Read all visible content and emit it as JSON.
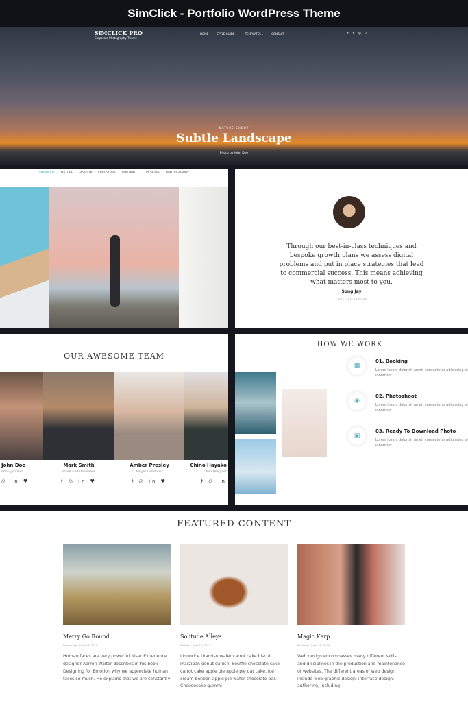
{
  "banner": {
    "title": "SimClick - Portfolio WordPress Theme"
  },
  "hero": {
    "logo": "SIMCLICK PRO",
    "tagline": "Corporate Photography Theme",
    "nav": [
      "HOME",
      "STYLE GUIDE ▾",
      "TEMPLATES ▾",
      "CONTACT"
    ],
    "social": [
      "f",
      "t",
      "◎",
      "⌕"
    ],
    "kicker": "NATURE SHOOT",
    "title": "Subtle Landscape",
    "caption": "Photo by John Doe"
  },
  "portfolio": {
    "tabs": [
      "SHOW ALL",
      "NATURE",
      "FASHION",
      "LANDSCAPE",
      "PORTRAIT",
      "CITY SCAPE",
      "PHOTOGRAPHY"
    ]
  },
  "testimonial": {
    "quote": "Through our best-in-class techniques and bespoke growth plans we assess digital problems and put in place strategies that lead to commercial success. This means achieving what matters most to you.",
    "name": "Song Jay",
    "role": "CFO, TAC Limited"
  },
  "team": {
    "title": "OUR AWESOME TEAM",
    "members": [
      {
        "name": "John Doe",
        "role": "Photographer",
        "icons": "◎ in ♥"
      },
      {
        "name": "Mark Smith",
        "role": "Front End Developer",
        "icons": "f ◎ in ♥"
      },
      {
        "name": "Amber Presley",
        "role": "Plugin Developer",
        "icons": "f ◎ in ♥"
      },
      {
        "name": "Chino Hayako",
        "role": "Web Designer",
        "icons": "f ◎ in"
      }
    ]
  },
  "how": {
    "title": "HOW WE WORK",
    "steps": [
      {
        "title": "01. Booking",
        "text": "Lorem ipsum dolor sit amet, consectetur adipiscing elit. Donec eu lobortiser."
      },
      {
        "title": "02. Photoshoot",
        "text": "Lorem ipsum dolor sit amet, consectetur adipiscing elit. Donec eu lobortiser."
      },
      {
        "title": "03. Ready To Download Photo",
        "text": "Lorem ipsum dolor sit amet, consectetur adipiscing elit. Donec eu lobortiser."
      }
    ]
  },
  "featured": {
    "title": "FEATURED CONTENT",
    "posts": [
      {
        "title": "Merry Go Round",
        "category": "Landscape",
        "date": "June 13, 2019",
        "excerpt": "Human faces are very powerful. User Experience designer Aarron Walter describes in his book Designing for Emotion why we appreciate human faces so much. He explains that we are constantly"
      },
      {
        "title": "Solitude Alleys",
        "category": "Fashion",
        "date": "June 13, 2019",
        "excerpt": "Liquorice tiramisu wafer carrot cake biscuit marzipan donut danish. Soufflé chocolate cake carrot cake apple pie apple pie oat cake. Ice cream bonbon apple pie wafer chocolate bar. Cheesecake gummi"
      },
      {
        "title": "Magic Karp",
        "category": "Featured",
        "date": "June 13, 2019",
        "excerpt": "Web design encompasses many different skills and disciplines in the production and maintenance of websites. The different areas of web design include web graphic design; interface design; authoring, including"
      }
    ]
  },
  "colors": {
    "accent": "#2ab0a0",
    "dark": "#16161e"
  }
}
